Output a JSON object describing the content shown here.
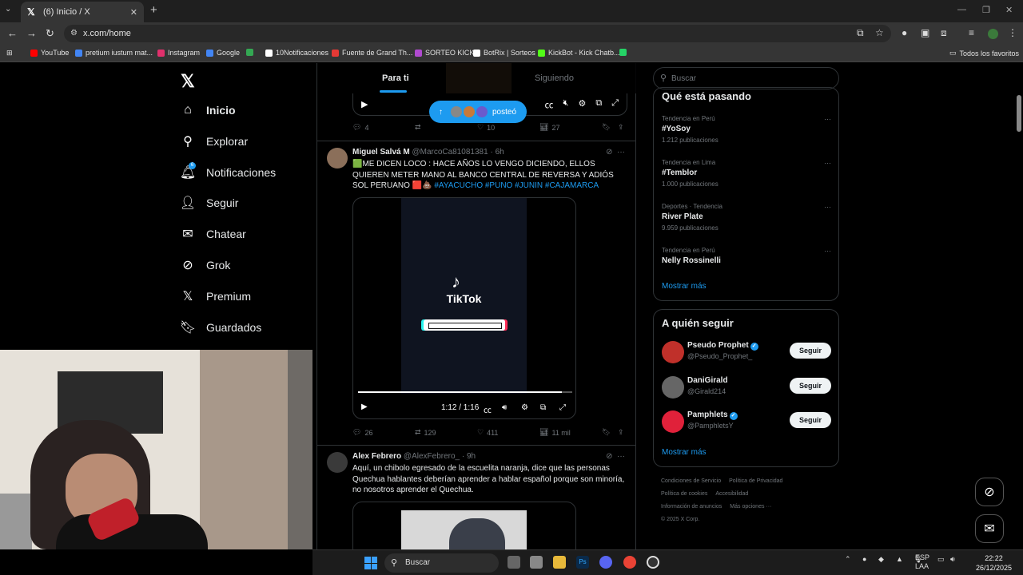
{
  "browser": {
    "tab_title": "(6) Inicio / X",
    "url": "x.com/home",
    "bookmarks": [
      {
        "label": "YouTube",
        "color": "#ff0000"
      },
      {
        "label": "pretium iustum mat...",
        "color": "#4285f4"
      },
      {
        "label": "Instagram",
        "color": "#e1306c"
      },
      {
        "label": "Google",
        "color": "#4285f4"
      },
      {
        "label": "",
        "color": "#34a853"
      },
      {
        "label": "10Notificaciones",
        "color": "#ffffff"
      },
      {
        "label": "Fuente de Grand Th...",
        "color": "#e53935"
      },
      {
        "label": "SORTEO KICK",
        "color": "#b04ad0"
      },
      {
        "label": "BotRix | Sorteos",
        "color": "#ffffff"
      },
      {
        "label": "KickBot - Kick Chatb...",
        "color": "#53fc18"
      },
      {
        "label": "",
        "color": "#25d366"
      }
    ],
    "all_bookmarks": "Todos los favoritos"
  },
  "nav": {
    "items": [
      {
        "label": "Inicio",
        "icon": "home-icon"
      },
      {
        "label": "Explorar",
        "icon": "search-icon"
      },
      {
        "label": "Notificaciones",
        "icon": "bell-icon",
        "badge": "6"
      },
      {
        "label": "Seguir",
        "icon": "person-add-icon"
      },
      {
        "label": "Chatear",
        "icon": "mail-icon"
      },
      {
        "label": "Grok",
        "icon": "grok-icon"
      },
      {
        "label": "Premium",
        "icon": "x-icon"
      },
      {
        "label": "Guardados",
        "icon": "bookmark-icon"
      }
    ]
  },
  "feed": {
    "tabs": [
      "Para ti",
      "Siguiendo"
    ],
    "posted_pill": "posteó",
    "top_actions": {
      "replies": "4",
      "reposts": "",
      "likes": "10",
      "views": "27"
    },
    "posts": [
      {
        "name": "Miguel Salvá M",
        "handle": "@MarcoCa81081381",
        "time": "· 6h",
        "text": "🟩ME DICEN LOCO : HACE AÑOS LO VENGO DICIENDO, ELLOS QUIEREN METER MANO AL BANCO CENTRAL DE REVERSA Y ADIÓS SOL PERUANO 🟥💩",
        "tags": "#AYACUCHO #PUNO #JUNIN #CAJAMARCA",
        "media_brand": "TikTok",
        "video_time": "1:12 / 1:16",
        "video_progress": 0.95,
        "replies": "26",
        "reposts": "129",
        "likes": "411",
        "views": "11 mil"
      },
      {
        "name": "Alex Febrero",
        "handle": "@AlexFebrero_",
        "time": "· 9h",
        "text": "Aquí, un chibolo egresado de la escuelita naranja, dice que las personas Quechua hablantes deberían aprender a hablar español porque son minoría, no nosotros aprender el Quechua."
      }
    ]
  },
  "right": {
    "search_placeholder": "Buscar",
    "trends_title": "Qué está pasando",
    "trends": [
      {
        "context": "Tendencia en Perú",
        "topic": "#YoSoy",
        "count": "1.212 publicaciones"
      },
      {
        "context": "Tendencia en Lima",
        "topic": "#Temblor",
        "count": "1.000 publicaciones"
      },
      {
        "context": "Deportes · Tendencia",
        "topic": "River Plate",
        "count": "9.959 publicaciones"
      },
      {
        "context": "Tendencia en Perú",
        "topic": "Nelly Rossinelli",
        "count": ""
      }
    ],
    "show_more": "Mostrar más",
    "who_title": "A quién seguir",
    "who": [
      {
        "name": "Pseudo Prophet",
        "handle": "@Pseudo_Prophet_",
        "verified": true,
        "color": "#c0302a"
      },
      {
        "name": "DaniGirald",
        "handle": "@Girald214",
        "verified": false,
        "color": "#666666"
      },
      {
        "name": "Pamphlets",
        "handle": "@PamphletsY",
        "verified": true,
        "color": "#e0213a"
      }
    ],
    "follow_label": "Seguir",
    "footer": [
      "Condiciones de Servicio",
      "Política de Privacidad",
      "Política de cookies",
      "Accesibilidad",
      "Información de anuncios",
      "Más opciones ···",
      "© 2025 X Corp."
    ]
  },
  "taskbar": {
    "search": "Buscar",
    "lang": "ESP",
    "lang2": "LAA",
    "time": "22:22",
    "date": "26/12/2025"
  }
}
